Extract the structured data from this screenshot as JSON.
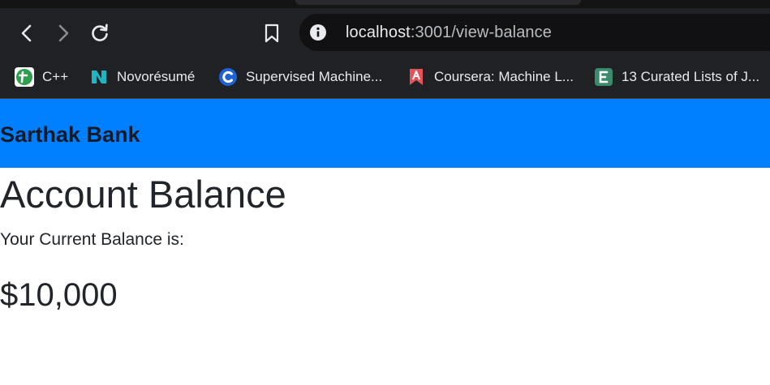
{
  "browser": {
    "url_host": "localhost",
    "url_path": ":3001/view-balance",
    "bookmarks": [
      {
        "label": "C++",
        "icon": "cpp-favicon",
        "color": "#2e9e4f"
      },
      {
        "label": "Novorésumé",
        "icon": "novoresume-favicon",
        "color": "#1fb6c2"
      },
      {
        "label": "Supervised Machine...",
        "icon": "coursera-c-favicon",
        "color": "#1f62d4"
      },
      {
        "label": "Coursera: Machine L...",
        "icon": "bookmark-red-favicon",
        "color": "#e6525a"
      },
      {
        "label": "13 Curated Lists of J...",
        "icon": "e-favicon",
        "color": "#3b8a6d"
      }
    ]
  },
  "app": {
    "brand": "Sarthak Bank",
    "brand_color": "#0080ff",
    "page_title": "Account Balance",
    "balance_label": "Your Current Balance is:",
    "balance_value": "$10,000"
  }
}
